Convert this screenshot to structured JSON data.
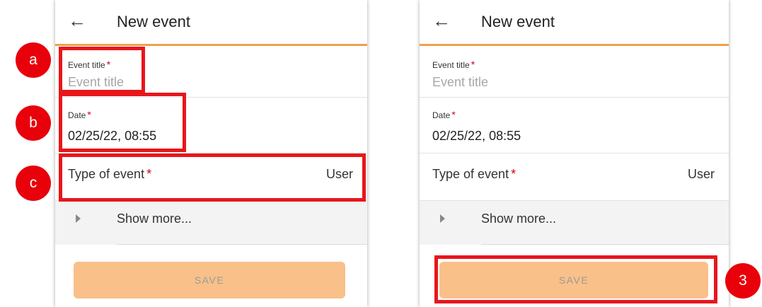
{
  "screens": [
    {
      "header": {
        "back_icon": "←",
        "title": "New event"
      },
      "event_title": {
        "label": "Event title",
        "required": "*",
        "placeholder": "Event title"
      },
      "date": {
        "label": "Date",
        "required": "*",
        "value": "02/25/22, 08:55"
      },
      "type_of_event": {
        "label": "Type of event",
        "required": "*",
        "value": "User"
      },
      "show_more": {
        "label": "Show more..."
      },
      "save": {
        "label": "SAVE"
      }
    },
    {
      "header": {
        "back_icon": "←",
        "title": "New event"
      },
      "event_title": {
        "label": "Event title",
        "required": "*",
        "placeholder": "Event title"
      },
      "date": {
        "label": "Date",
        "required": "*",
        "value": "02/25/22, 08:55"
      },
      "type_of_event": {
        "label": "Type of event",
        "required": "*",
        "value": "User"
      },
      "show_more": {
        "label": "Show more..."
      },
      "save": {
        "label": "SAVE"
      }
    }
  ],
  "callouts": {
    "a": "a",
    "b": "b",
    "c": "c",
    "step3": "3"
  },
  "colors": {
    "accent": "#f0a04b",
    "save_bg": "#f9c08a",
    "highlight": "#e8161c",
    "required": "#d0021b"
  }
}
